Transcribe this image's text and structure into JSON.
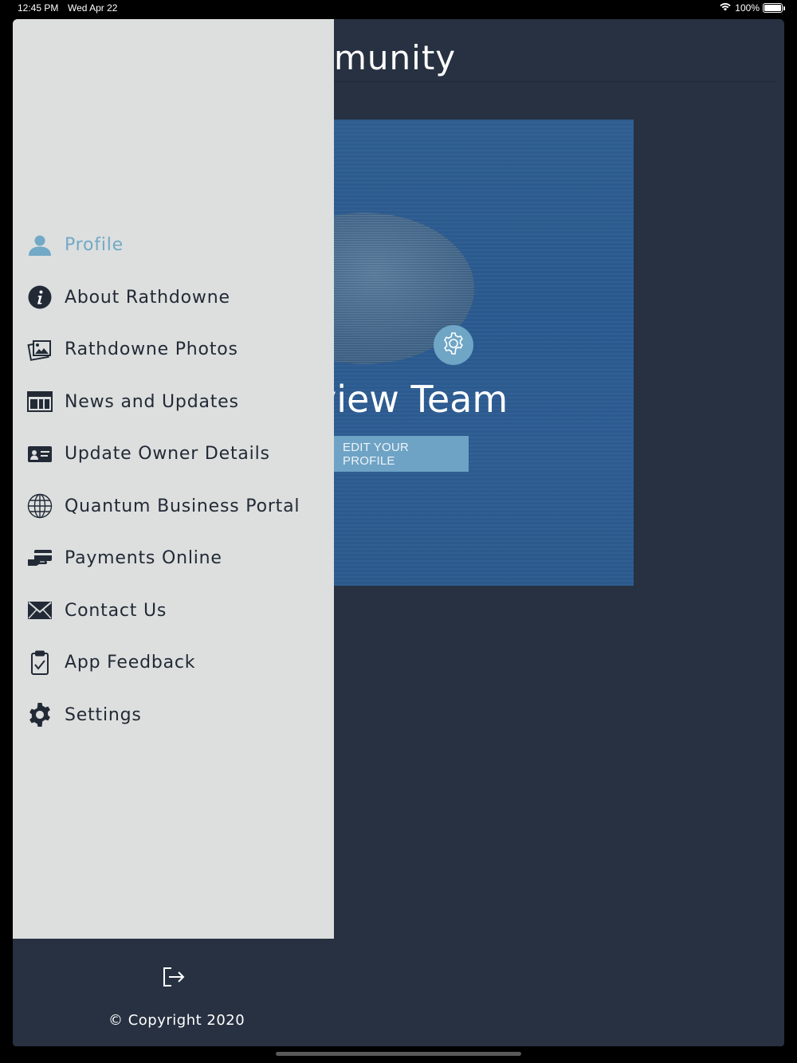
{
  "status_bar": {
    "time": "12:45 PM",
    "date": "Wed Apr 22",
    "battery": "100%"
  },
  "background": {
    "header_title": "munity",
    "team_title": "view Team",
    "edit_profile_label": "EDIT YOUR PROFILE"
  },
  "drawer": {
    "items": [
      {
        "label": "Profile",
        "icon": "user-icon",
        "active": true
      },
      {
        "label": "About Rathdowne",
        "icon": "info-icon"
      },
      {
        "label": "Rathdowne Photos",
        "icon": "photos-icon"
      },
      {
        "label": "News and Updates",
        "icon": "news-icon"
      },
      {
        "label": "Update Owner Details",
        "icon": "id-card-icon"
      },
      {
        "label": "Quantum Business Portal",
        "icon": "globe-icon"
      },
      {
        "label": "Payments Online",
        "icon": "payment-icon"
      },
      {
        "label": "Contact Us",
        "icon": "envelope-icon"
      },
      {
        "label": "App Feedback",
        "icon": "clipboard-check-icon"
      },
      {
        "label": "Settings",
        "icon": "gear-icon"
      }
    ]
  },
  "footer": {
    "copyright": "© Copyright 2020"
  },
  "colors": {
    "app_bg": "#273141",
    "drawer_bg": "#dcdfde",
    "accent": "#72a9c6",
    "card_bg": "#2c5b90",
    "text_dark": "#222a36"
  }
}
